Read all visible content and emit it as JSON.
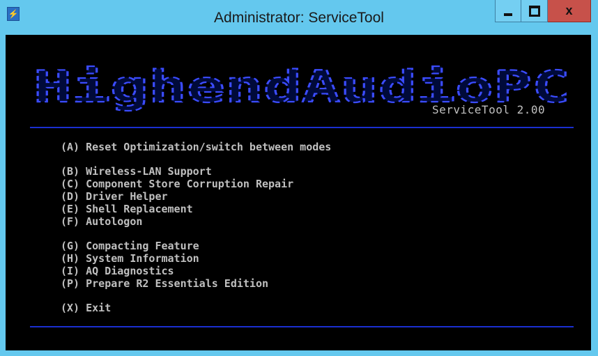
{
  "window": {
    "title": "Administrator: ServiceTool",
    "icon": "console-app-icon",
    "controls": {
      "minimize_icon": "minimize-icon",
      "maximize_icon": "maximize-icon",
      "close_icon": "close-icon",
      "close_glyph": "x"
    }
  },
  "console": {
    "logo_text": "HighendAudioPC",
    "version": "ServiceTool 2.00",
    "menu_groups": [
      [
        "(A) Reset Optimization/switch between modes"
      ],
      [
        "(B) Wireless-LAN Support",
        "(C) Component Store Corruption Repair",
        "(D) Driver Helper",
        "(E) Shell Replacement",
        "(F) Autologon"
      ],
      [
        "(G) Compacting Feature",
        "(H) System Information",
        "(I) AQ Diagnostics",
        "(P) Prepare R2 Essentials Edition"
      ],
      [
        "(X) Exit"
      ]
    ]
  },
  "colors": {
    "titlebar": "#64c8ee",
    "close_button": "#c7514a",
    "console_bg": "#000000",
    "console_text": "#c0c0c0",
    "rule_blue": "#1a2fd0",
    "logo_blue": "#3b4cff"
  }
}
